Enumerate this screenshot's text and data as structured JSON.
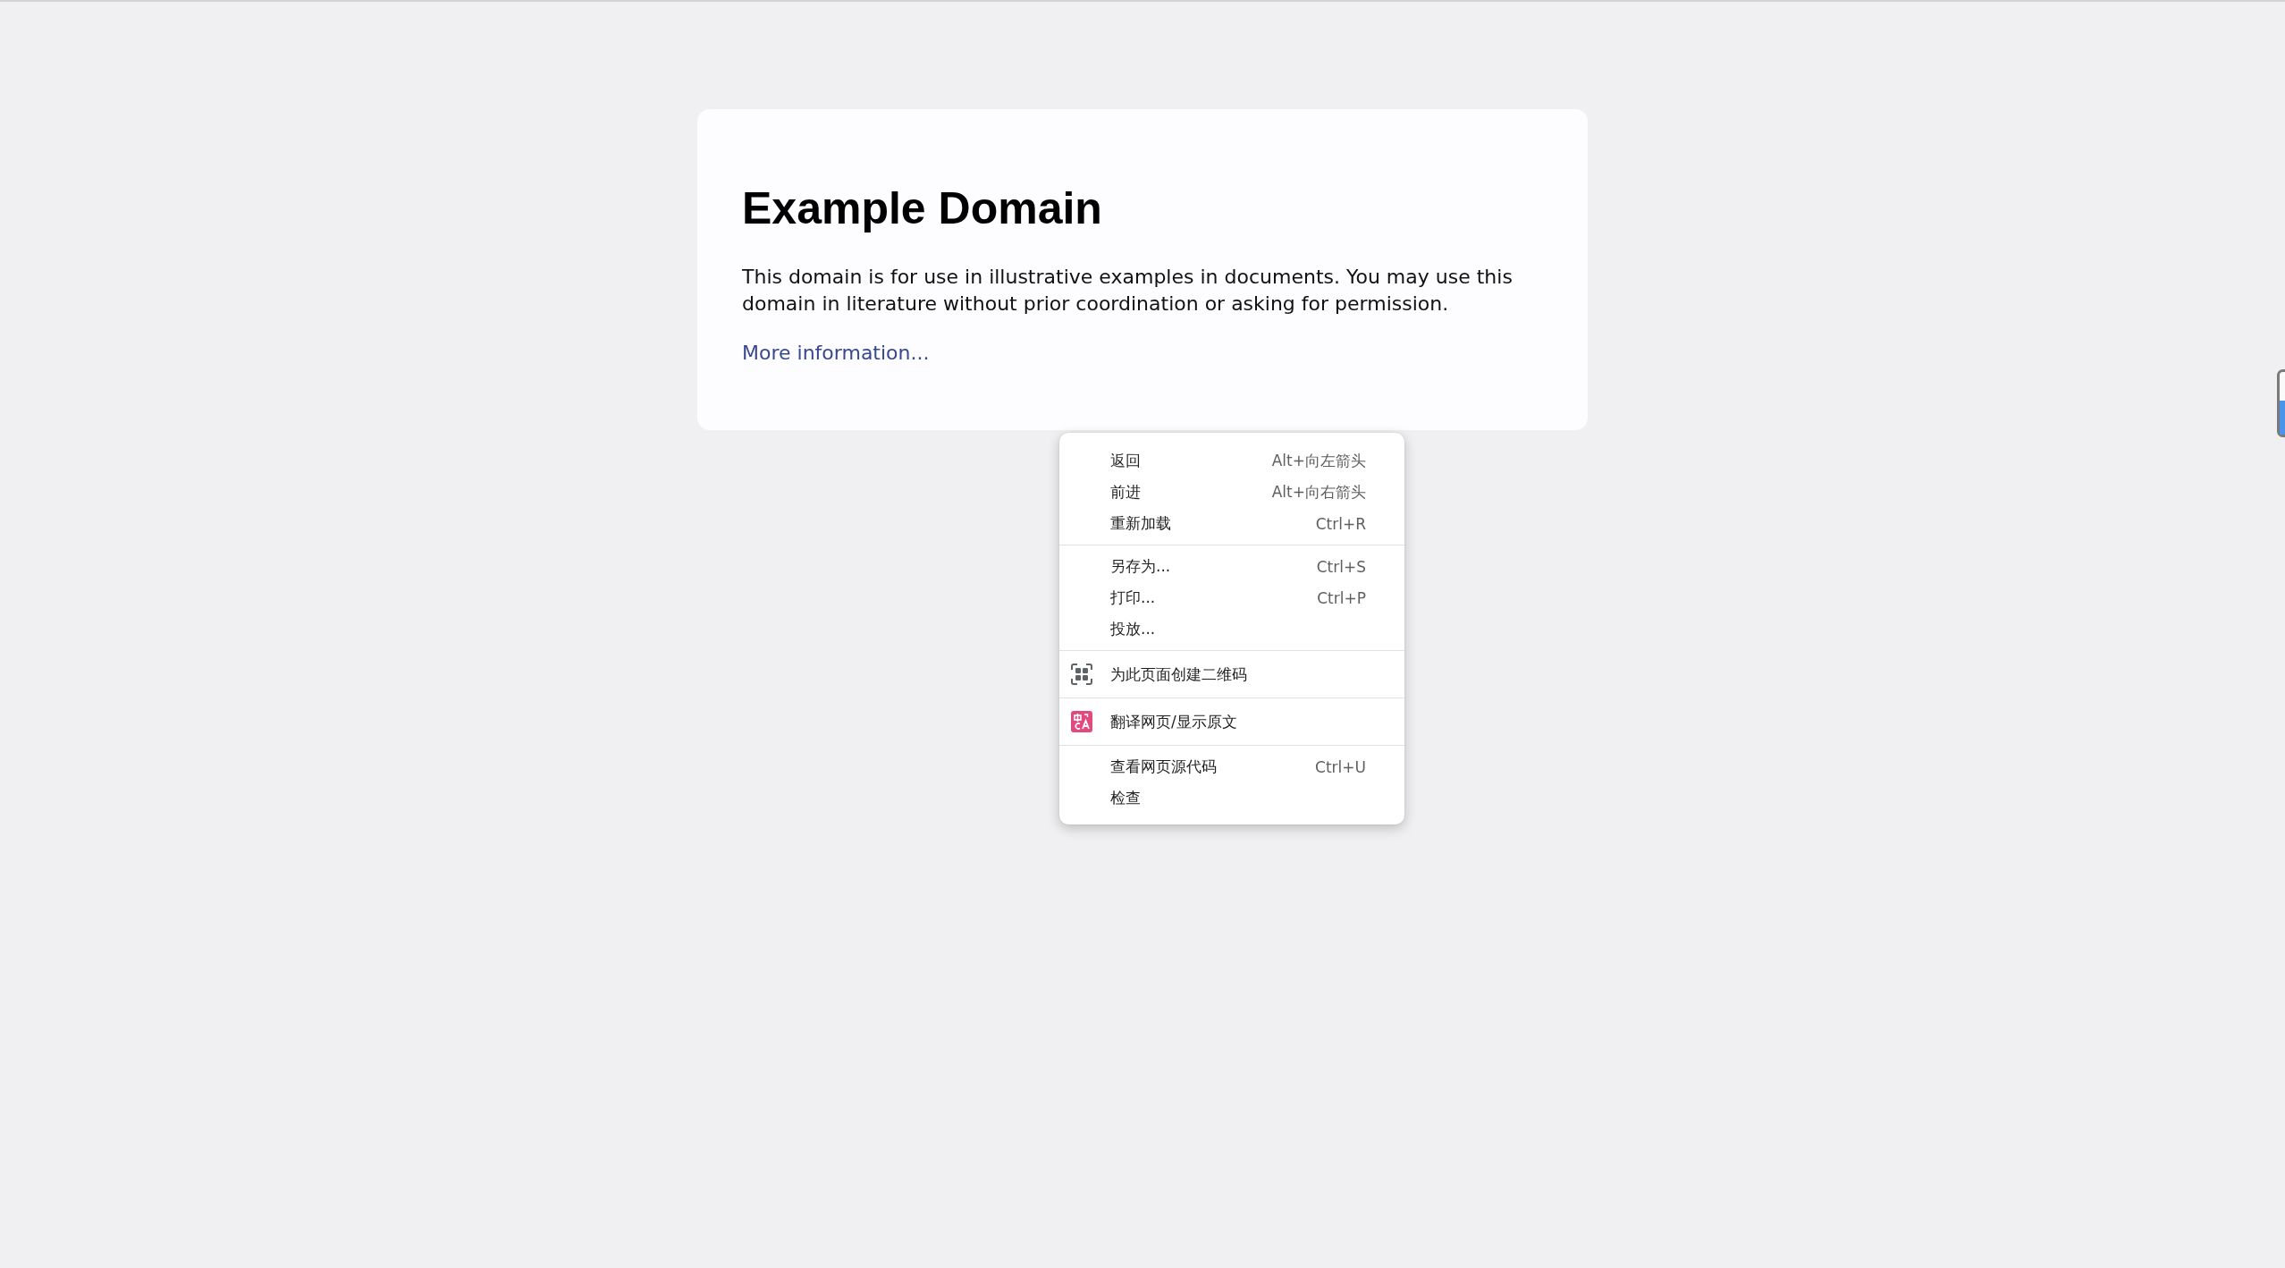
{
  "page": {
    "heading": "Example Domain",
    "paragraph": "This domain is for use in illustrative examples in documents. You may use this domain in literature without prior coordination or asking for permission.",
    "link": "More information..."
  },
  "context_menu": {
    "groups": [
      {
        "items": [
          {
            "kind": "text",
            "label": "返回",
            "shortcut": "Alt+向左箭头"
          },
          {
            "kind": "text",
            "label": "前进",
            "shortcut": "Alt+向右箭头"
          },
          {
            "kind": "text",
            "label": "重新加载",
            "shortcut": "Ctrl+R"
          }
        ]
      },
      {
        "items": [
          {
            "kind": "text",
            "label": "另存为...",
            "shortcut": "Ctrl+S"
          },
          {
            "kind": "text",
            "label": "打印...",
            "shortcut": "Ctrl+P"
          },
          {
            "kind": "text",
            "label": "投放..."
          }
        ]
      },
      {
        "items": [
          {
            "kind": "qrcode",
            "label": "为此页面创建二维码"
          }
        ]
      },
      {
        "items": [
          {
            "kind": "translate",
            "label": "翻译网页/显示原文"
          }
        ]
      },
      {
        "items": [
          {
            "kind": "text",
            "label": "查看网页源代码",
            "shortcut": "Ctrl+U"
          },
          {
            "kind": "text",
            "label": "检查"
          }
        ]
      }
    ]
  }
}
